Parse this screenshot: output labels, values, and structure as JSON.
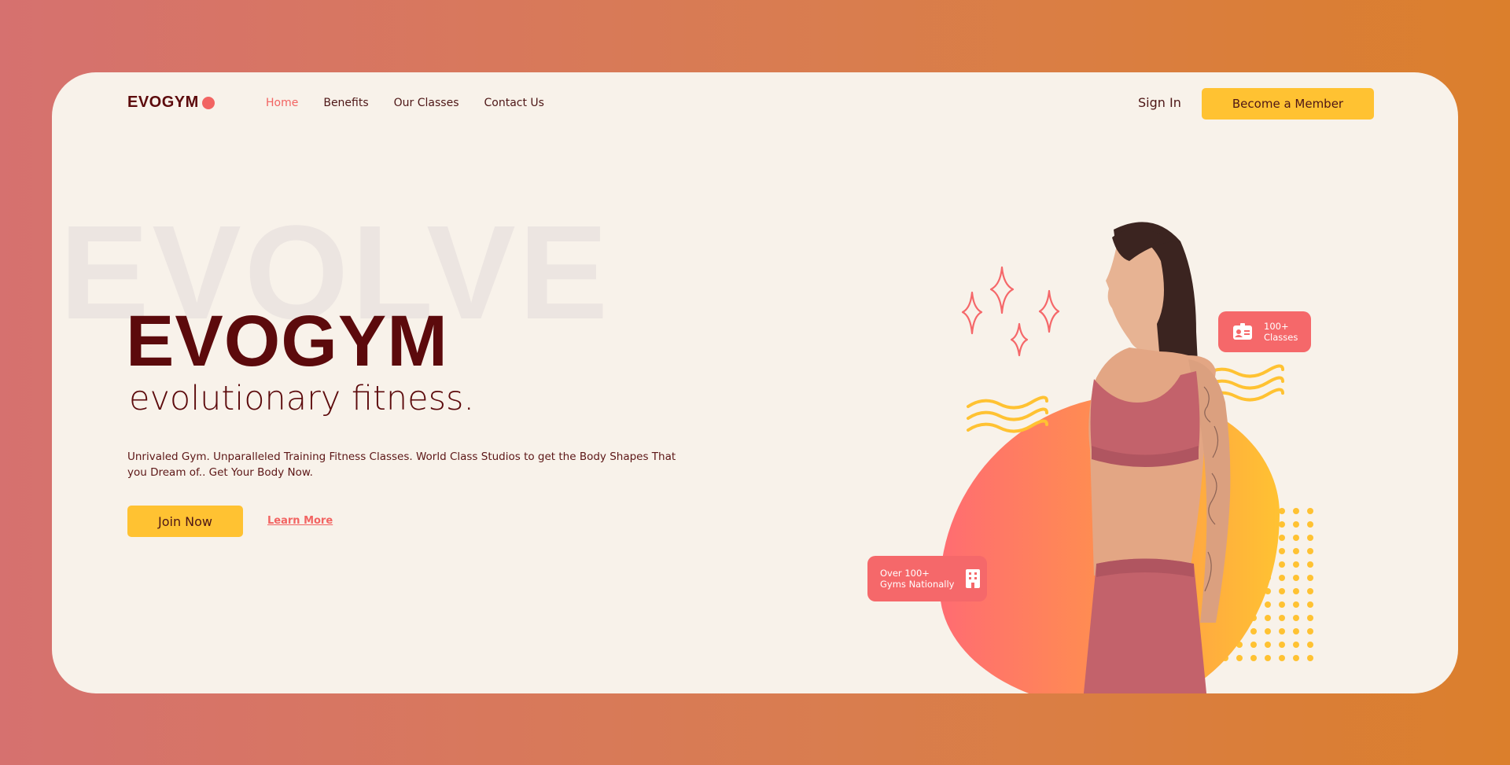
{
  "brand": {
    "name": "EVOGYM"
  },
  "nav": {
    "items": [
      {
        "label": "Home",
        "active": true
      },
      {
        "label": "Benefits",
        "active": false
      },
      {
        "label": "Our Classes",
        "active": false
      },
      {
        "label": "Contact Us",
        "active": false
      }
    ],
    "sign_in": "Sign In",
    "member_button": "Become a Member"
  },
  "hero": {
    "watermark": "EVOLVE",
    "title": "EVOGYM",
    "subtitle": "evolutionary fitness.",
    "description": "Unrivaled Gym. Unparalleled Training Fitness Classes. World Class Studios to get the Body Shapes That you Dream of.. Get Your Body Now.",
    "join_button": "Join Now",
    "learn_more": "Learn More"
  },
  "badges": {
    "classes": {
      "line1": "100+",
      "line2": "Classes",
      "icon": "id-card-icon"
    },
    "gyms": {
      "line1": "Over 100+",
      "line2": "Gyms Nationally",
      "icon": "building-icon"
    }
  },
  "colors": {
    "brand_dark": "#5c0a0c",
    "accent_coral": "#f26462",
    "accent_yellow": "#ffc232",
    "card_bg": "#f8f2ea"
  }
}
